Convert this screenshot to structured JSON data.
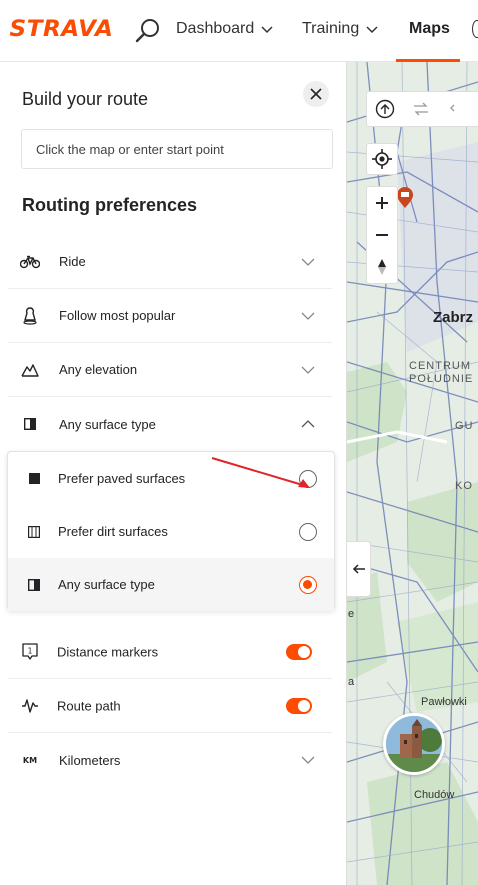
{
  "nav": {
    "logo": "STRAVA",
    "items": [
      {
        "label": "Dashboard"
      },
      {
        "label": "Training"
      },
      {
        "label": "Maps"
      }
    ]
  },
  "panel": {
    "title": "Build your route",
    "start_placeholder": "Click the map or enter start point",
    "routing_title": "Routing preferences",
    "prefs": [
      {
        "label": "Ride",
        "icon": "bike-icon"
      },
      {
        "label": "Follow most popular",
        "icon": "popularity-icon"
      },
      {
        "label": "Any elevation",
        "icon": "elevation-icon"
      },
      {
        "label": "Any surface type",
        "icon": "surface-icon"
      }
    ],
    "surface_options": [
      {
        "label": "Prefer paved surfaces",
        "selected": false
      },
      {
        "label": "Prefer dirt surfaces",
        "selected": false
      },
      {
        "label": "Any surface type",
        "selected": true
      }
    ],
    "toggles": [
      {
        "label": "Distance markers",
        "on": true
      },
      {
        "label": "Route path",
        "on": true
      }
    ],
    "units": {
      "label": "Kilometers",
      "icon_text": "KM"
    }
  },
  "map": {
    "labels": {
      "city": "Zabrz",
      "district1": "CENTRUM",
      "district2": "POŁUDNIE",
      "fragment1": "GU",
      "fragment2": "KO",
      "fragment3": "e",
      "fragment4": "a",
      "village1": "Pawłowki",
      "village2": "Chudów"
    }
  },
  "colors": {
    "brand": "#fc4c02",
    "map_bg": "#e8efe7",
    "road": "#6b7fb5",
    "park": "#cfe3c9"
  }
}
